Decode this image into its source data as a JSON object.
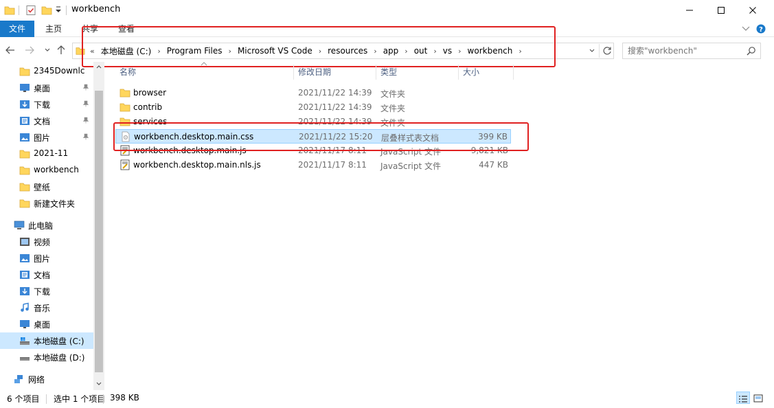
{
  "window": {
    "title": "workbench",
    "controls": {
      "minimize": "minimize-icon",
      "maximize": "maximize-icon",
      "close": "close-icon"
    }
  },
  "ribbon": {
    "tabs": [
      "文件",
      "主页",
      "共享",
      "查看"
    ]
  },
  "address": {
    "overflow": "«",
    "crumbs": [
      "本地磁盘 (C:)",
      "Program Files",
      "Microsoft VS Code",
      "resources",
      "app",
      "out",
      "vs",
      "workbench"
    ]
  },
  "search": {
    "placeholder": "搜索\"workbench\""
  },
  "nav": {
    "quick_access": [
      {
        "label": "2345Downlc",
        "icon": "folder-icon",
        "pinned": false
      },
      {
        "label": "桌面",
        "icon": "desktop-icon",
        "pinned": true
      },
      {
        "label": "下载",
        "icon": "download-icon",
        "pinned": true
      },
      {
        "label": "文档",
        "icon": "documents-icon",
        "pinned": true
      },
      {
        "label": "图片",
        "icon": "pictures-icon",
        "pinned": true
      },
      {
        "label": "2021-11",
        "icon": "folder-icon",
        "pinned": false
      },
      {
        "label": "workbench",
        "icon": "folder-icon",
        "pinned": false
      },
      {
        "label": "壁纸",
        "icon": "folder-icon",
        "pinned": false
      },
      {
        "label": "新建文件夹",
        "icon": "folder-icon",
        "pinned": false
      }
    ],
    "this_pc": "此电脑",
    "pc_items": [
      {
        "label": "视频",
        "icon": "videos-icon",
        "selected": false
      },
      {
        "label": "图片",
        "icon": "pictures-icon",
        "selected": false
      },
      {
        "label": "文档",
        "icon": "documents-icon",
        "selected": false
      },
      {
        "label": "下载",
        "icon": "download-icon",
        "selected": false
      },
      {
        "label": "音乐",
        "icon": "music-icon",
        "selected": false
      },
      {
        "label": "桌面",
        "icon": "desktop-icon",
        "selected": false
      },
      {
        "label": "本地磁盘 (C:)",
        "icon": "drive-icon",
        "selected": true
      },
      {
        "label": "本地磁盘 (D:)",
        "icon": "drive-icon",
        "selected": false
      }
    ],
    "network": "网络"
  },
  "columns": {
    "name": "名称",
    "date": "修改日期",
    "type": "类型",
    "size": "大小"
  },
  "files": [
    {
      "name": "browser",
      "date": "2021/11/22 14:39",
      "type": "文件夹",
      "size": "",
      "icon": "folder-icon",
      "selected": false
    },
    {
      "name": "contrib",
      "date": "2021/11/22 14:39",
      "type": "文件夹",
      "size": "",
      "icon": "folder-icon",
      "selected": false
    },
    {
      "name": "services",
      "date": "2021/11/22 14:39",
      "type": "文件夹",
      "size": "",
      "icon": "folder-icon",
      "selected": false
    },
    {
      "name": "workbench.desktop.main.css",
      "date": "2021/11/22 15:20",
      "type": "层叠样式表文档",
      "size": "399 KB",
      "icon": "css-file-icon",
      "selected": true
    },
    {
      "name": "workbench.desktop.main.js",
      "date": "2021/11/17 8:11",
      "type": "JavaScript 文件",
      "size": "9,821 KB",
      "icon": "js-file-icon",
      "selected": false
    },
    {
      "name": "workbench.desktop.main.nls.js",
      "date": "2021/11/17 8:11",
      "type": "JavaScript 文件",
      "size": "447 KB",
      "icon": "js-file-icon",
      "selected": false
    }
  ],
  "status": {
    "count": "6 个项目",
    "selection": "选中 1 个项目",
    "size": "398 KB"
  },
  "colors": {
    "accent": "#1979ca",
    "selection": "#cce8ff",
    "annotation": "#e02020",
    "folder": "#ffd65c"
  }
}
